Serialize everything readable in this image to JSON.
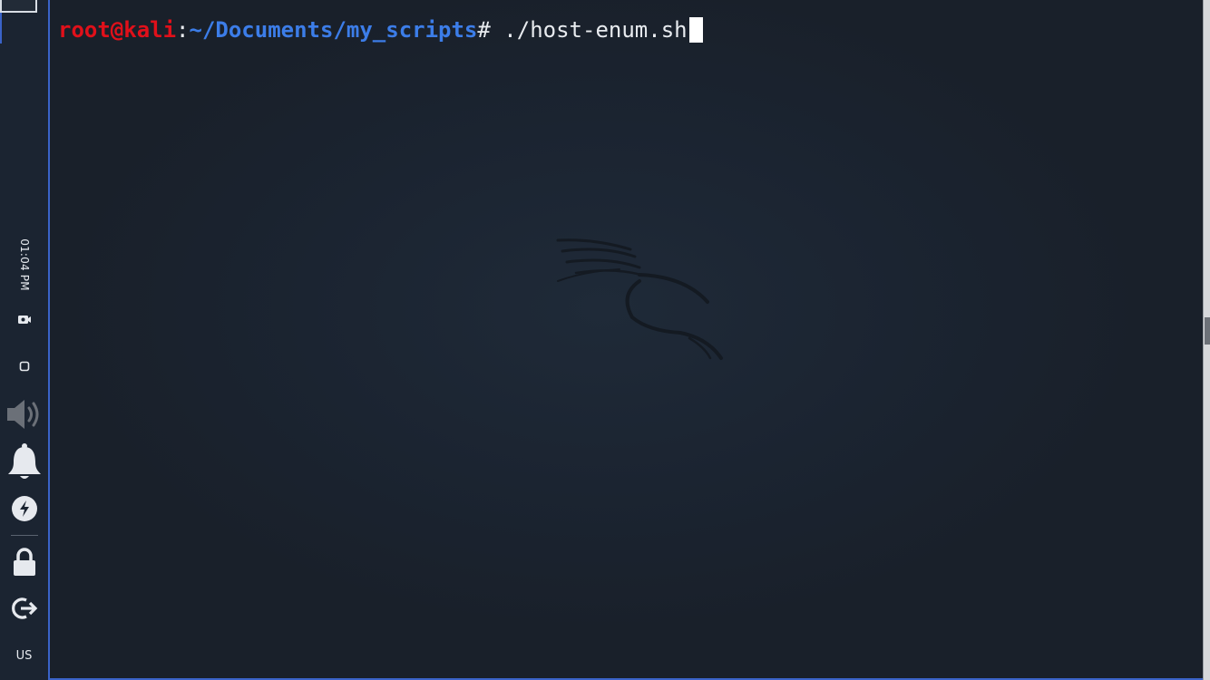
{
  "panel": {
    "clock": "01:04 PM",
    "keyboard_layout": "US",
    "icons": [
      "workspace-button",
      "camera-icon",
      "display-icon",
      "volume-icon",
      "bell-icon",
      "power-icon",
      "lock-icon",
      "logout-icon"
    ]
  },
  "terminal": {
    "prompt_user": "root@kali",
    "prompt_colon": ":",
    "prompt_path": "~/Documents/my_scripts",
    "prompt_symbol": "# ",
    "command": "./host-enum.sh",
    "colors": {
      "user": "#e0101a",
      "path": "#3c7de8",
      "text": "#e8ebef",
      "background": "#1b2431",
      "accent_border": "#3a63c8"
    }
  }
}
